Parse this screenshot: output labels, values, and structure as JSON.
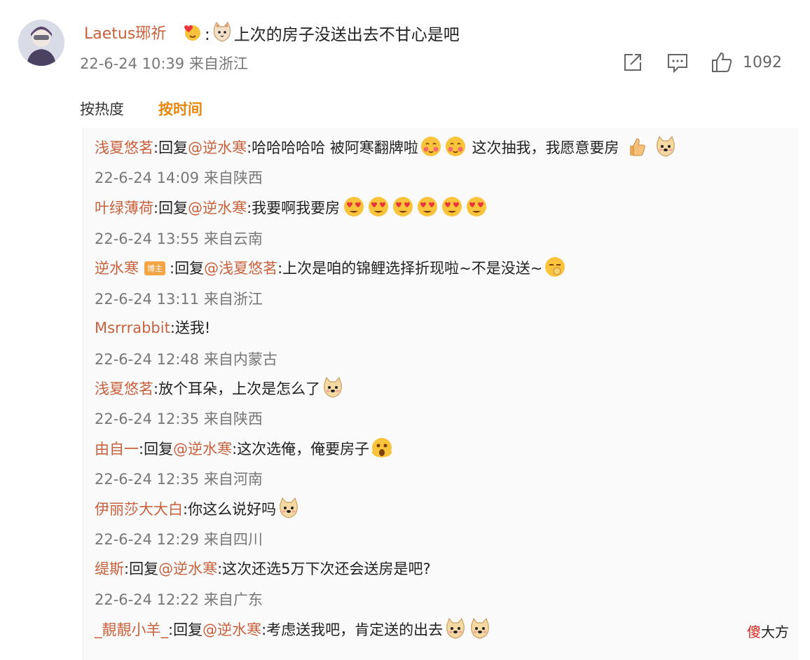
{
  "main_comment": {
    "username": "Laetus琊祈",
    "text": "上次的房子没送出去不甘心是吧",
    "emoji_icons": [
      "heart-face-emoji-icon",
      "cat-emoji-icon"
    ],
    "meta": "22-6-24 10:39 来自浙江",
    "likes": "1092"
  },
  "tabs": {
    "hot": "按热度",
    "time": "按时间",
    "active": "time"
  },
  "replies": [
    {
      "name": "浅夏悠茗",
      "sep1": ":回复",
      "at": "@逆水寒",
      "text": ":哈哈哈哈哈 被阿寒翻牌啦",
      "emoji1": "blush-emoji-icon",
      "emoji2": "blush-emoji-icon",
      "tail": " 这次抽我，我愿意要房",
      "meta": "22-6-24 14:09 来自陕西"
    },
    {
      "name": "叶绿薄荷",
      "sep1": ":回复",
      "at": "@逆水寒",
      "text": ":我要啊我要房",
      "emoji_count": 6,
      "meta": "22-6-24 13:55 来自云南"
    },
    {
      "name": "逆水寒",
      "badge": "博主",
      "sep1": ":回复",
      "at": "@浅夏悠茗",
      "text": ":上次是咱的锦鲤选择折现啦~不是没送~",
      "meta": "22-6-24 13:11 来自浙江"
    },
    {
      "name": "Msrrrabbit",
      "text": ":送我!",
      "meta": "22-6-24 12:48 来自内蒙古"
    },
    {
      "name": "浅夏悠茗",
      "text": ":放个耳朵，上次是怎么了",
      "meta": "22-6-24 12:35 来自陕西"
    },
    {
      "name": "由自一",
      "sep1": ":回复",
      "at": "@逆水寒",
      "text": ":这次选俺，俺要房子",
      "meta": "22-6-24 12:35 来自河南"
    },
    {
      "name": "伊丽莎大大白",
      "text": ":你这么说好吗",
      "meta": "22-6-24 12:29 来自四川"
    },
    {
      "name": "缇斯",
      "sep1": ":回复",
      "at": "@逆水寒",
      "text": ":这次还选5万下次还会送房是吧?",
      "meta": "22-6-24 12:22 来自广东"
    },
    {
      "name": "_靚靚小羊_",
      "sep1": ":回复",
      "at": "@逆水寒",
      "text": ":考虑送我吧，肯定送的出去"
    }
  ],
  "watermark": {
    "red": "傻",
    "rest": "大方"
  },
  "colors": {
    "username": "#c8623e",
    "active_tab": "#e8870f",
    "badge": "#f3a443",
    "meta": "#777777"
  }
}
